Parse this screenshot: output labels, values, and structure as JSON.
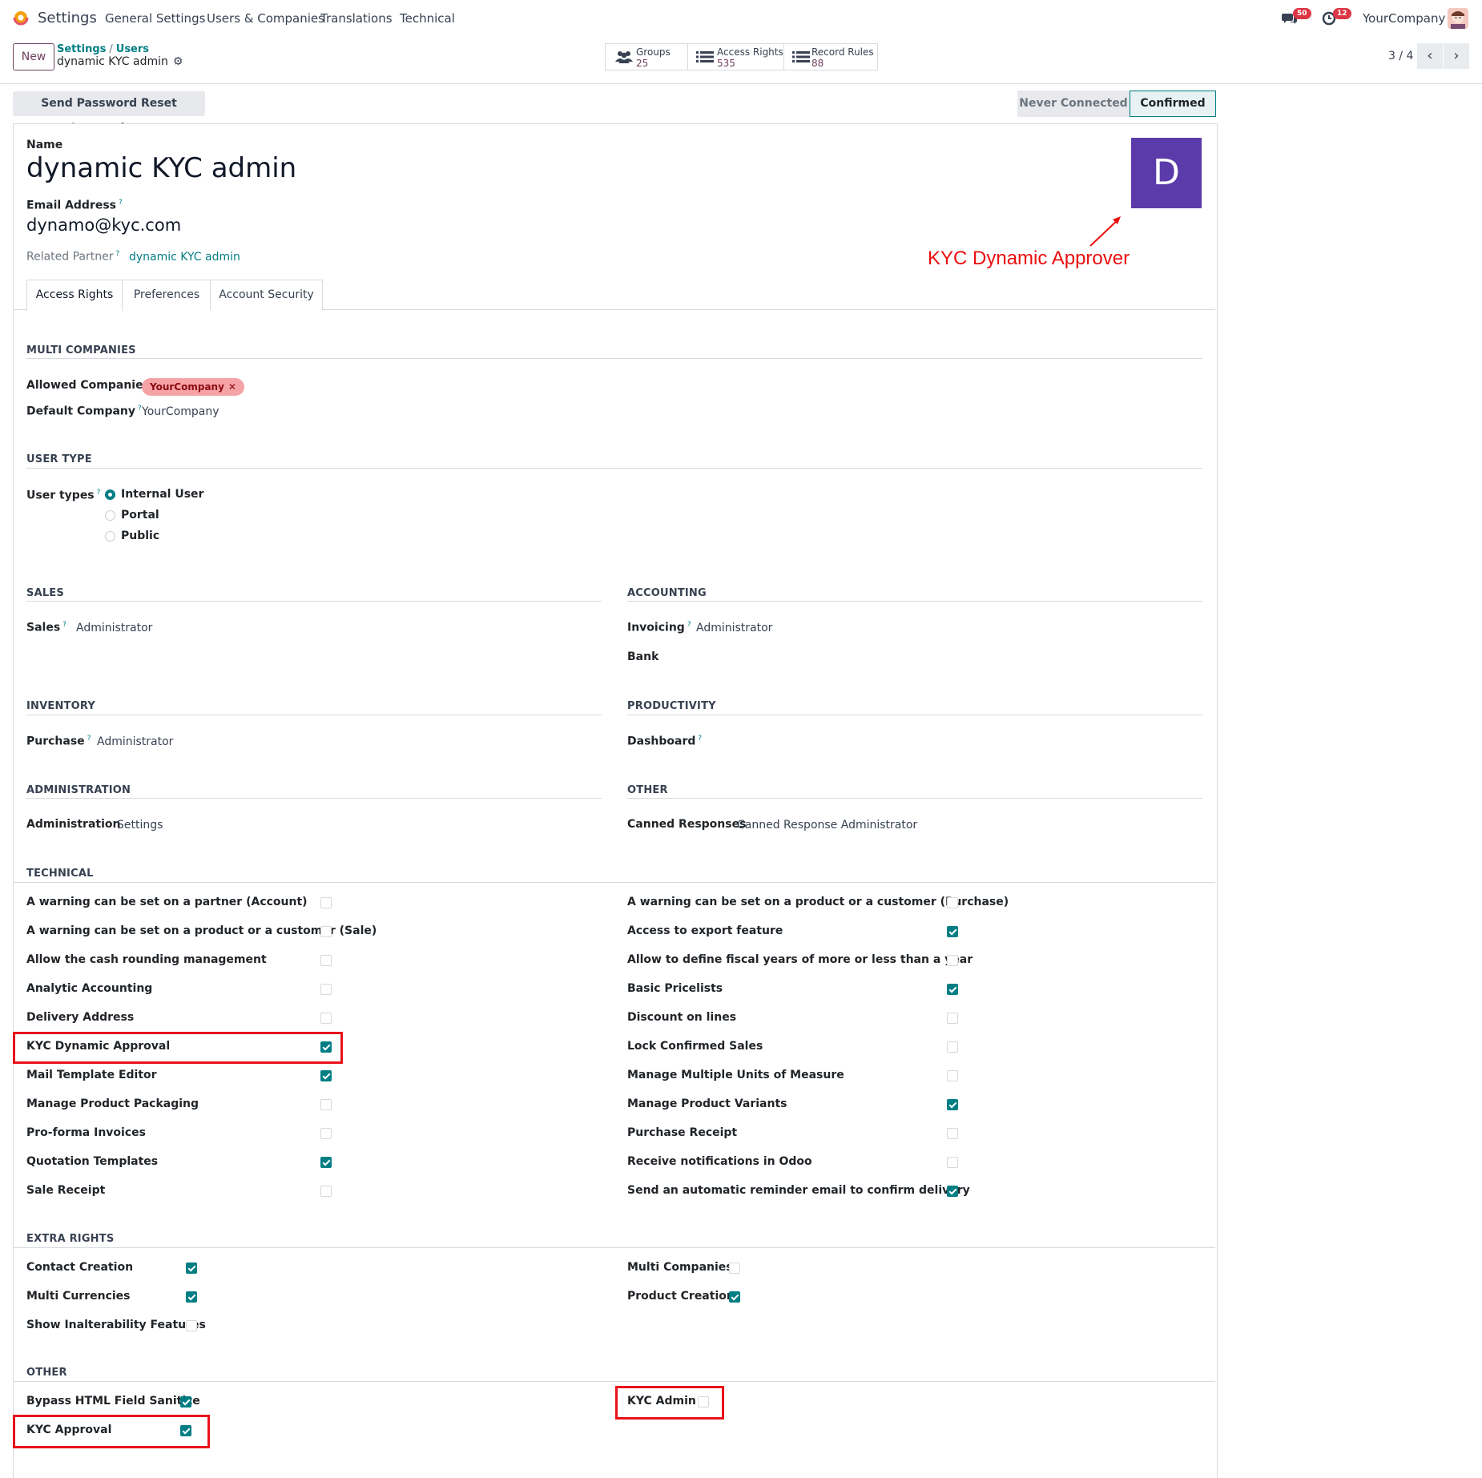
{
  "navbar": {
    "app_name": "Settings",
    "menu": [
      "General Settings",
      "Users & Companies",
      "Translations",
      "Technical"
    ],
    "chat_badge": "50",
    "activity_badge": "12",
    "company": "YourCompany"
  },
  "control": {
    "new_label": "New",
    "breadcrumb": [
      "Settings",
      "Users"
    ],
    "current": "dynamic KYC admin",
    "stats": [
      {
        "label": "Groups",
        "value": "25"
      },
      {
        "label": "Access Rights",
        "value": "535"
      },
      {
        "label": "Record Rules",
        "value": "88"
      }
    ],
    "pager": "3 / 4"
  },
  "statusbar": {
    "reset_label": "Send Password Reset Instructions",
    "stages": [
      "Never Connected",
      "Confirmed"
    ],
    "active_stage": "Confirmed"
  },
  "form": {
    "name_label": "Name",
    "name": "dynamic KYC admin",
    "email_label": "Email Address",
    "email": "dynamo@kyc.com",
    "partner_label": "Related Partner",
    "partner": "dynamic KYC admin",
    "avatar_letter": "D",
    "annotation": "KYC Dynamic Approver",
    "tabs": [
      "Access Rights",
      "Preferences",
      "Account Security"
    ],
    "help_mark": "?"
  },
  "multi_companies": {
    "title": "MULTI COMPANIES",
    "allowed_label": "Allowed Companies",
    "allowed_tag": "YourCompany",
    "default_label": "Default Company",
    "default_value": "YourCompany"
  },
  "user_type": {
    "title": "USER TYPE",
    "label": "User types",
    "options": [
      "Internal User",
      "Portal",
      "Public"
    ],
    "selected": 0
  },
  "sales": {
    "title": "SALES",
    "label": "Sales",
    "value": "Administrator"
  },
  "accounting": {
    "title": "ACCOUNTING",
    "invoicing_label": "Invoicing",
    "invoicing_value": "Administrator",
    "bank_label": "Bank"
  },
  "inventory": {
    "title": "INVENTORY",
    "label": "Purchase",
    "value": "Administrator"
  },
  "productivity": {
    "title": "PRODUCTIVITY",
    "label": "Dashboard"
  },
  "administration": {
    "title": "ADMINISTRATION",
    "label": "Administration",
    "value": "Settings"
  },
  "other_apps": {
    "title": "OTHER",
    "label": "Canned Responses",
    "value": "Canned Response Administrator"
  },
  "technical": {
    "title": "TECHNICAL",
    "left": [
      {
        "label": "A warning can be set on a partner (Account)",
        "checked": false
      },
      {
        "label": "A warning can be set on a product or a customer (Sale)",
        "checked": false
      },
      {
        "label": "Allow the cash rounding management",
        "checked": false
      },
      {
        "label": "Analytic Accounting",
        "checked": false
      },
      {
        "label": "Delivery Address",
        "checked": false
      },
      {
        "label": "KYC Dynamic Approval",
        "checked": true
      },
      {
        "label": "Mail Template Editor",
        "checked": true
      },
      {
        "label": "Manage Product Packaging",
        "checked": false
      },
      {
        "label": "Pro-forma Invoices",
        "checked": false
      },
      {
        "label": "Quotation Templates",
        "checked": true
      },
      {
        "label": "Sale Receipt",
        "checked": false
      }
    ],
    "right": [
      {
        "label": "A warning can be set on a product or a customer (Purchase)",
        "checked": false
      },
      {
        "label": "Access to export feature",
        "checked": true
      },
      {
        "label": "Allow to define fiscal years of more or less than a year",
        "checked": false
      },
      {
        "label": "Basic Pricelists",
        "checked": true
      },
      {
        "label": "Discount on lines",
        "checked": false
      },
      {
        "label": "Lock Confirmed Sales",
        "checked": false
      },
      {
        "label": "Manage Multiple Units of Measure",
        "checked": false
      },
      {
        "label": "Manage Product Variants",
        "checked": true
      },
      {
        "label": "Purchase Receipt",
        "checked": false
      },
      {
        "label": "Receive notifications in Odoo",
        "checked": false
      },
      {
        "label": "Send an automatic reminder email to confirm delivery",
        "checked": true
      }
    ]
  },
  "extra_rights": {
    "title": "EXTRA RIGHTS",
    "left": [
      {
        "label": "Contact Creation",
        "checked": true
      },
      {
        "label": "Multi Currencies",
        "checked": true
      },
      {
        "label": "Show Inalterability Features",
        "checked": false
      }
    ],
    "right": [
      {
        "label": "Multi Companies",
        "checked": false
      },
      {
        "label": "Product Creation",
        "checked": true
      }
    ]
  },
  "other": {
    "title": "OTHER",
    "left": [
      {
        "label": "Bypass HTML Field Sanitize",
        "checked": true
      },
      {
        "label": "KYC Approval",
        "checked": true
      }
    ],
    "right": [
      {
        "label": "KYC Admin",
        "checked": false
      }
    ]
  },
  "colors": {
    "accent": "#017e84",
    "brand": "#71405f",
    "annotation": "#ea0f0f",
    "avatar": "#5b3ba9"
  }
}
